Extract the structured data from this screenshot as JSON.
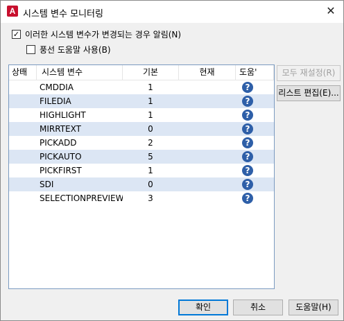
{
  "window": {
    "title": "시스템 변수 모니터링",
    "app_icon_letter": "A",
    "close_glyph": "✕"
  },
  "options": {
    "notify_label": "이러한 시스템 변수가 변경되는 경우 알림(N)",
    "notify_checked": true,
    "balloon_label": "풍선 도움말 사용(B)",
    "balloon_checked": false
  },
  "grid": {
    "columns": {
      "status": "상태",
      "name": "시스템 변수",
      "default": "기본",
      "current": "현재",
      "help": "도움'"
    },
    "rows": [
      {
        "name": "CMDDIA",
        "default": "1",
        "current": ""
      },
      {
        "name": "FILEDIA",
        "default": "1",
        "current": ""
      },
      {
        "name": "HIGHLIGHT",
        "default": "1",
        "current": ""
      },
      {
        "name": "MIRRTEXT",
        "default": "0",
        "current": ""
      },
      {
        "name": "PICKADD",
        "default": "2",
        "current": ""
      },
      {
        "name": "PICKAUTO",
        "default": "5",
        "current": ""
      },
      {
        "name": "PICKFIRST",
        "default": "1",
        "current": ""
      },
      {
        "name": "SDI",
        "default": "0",
        "current": ""
      },
      {
        "name": "SELECTIONPREVIEW",
        "default": "3",
        "current": ""
      }
    ],
    "help_glyph": "?"
  },
  "side_buttons": {
    "reset_all": "모두 재설정(R)",
    "edit_list": "리스트 편집(E)..."
  },
  "footer": {
    "ok": "확인",
    "cancel": "취소",
    "help": "도움말(H)"
  },
  "colors": {
    "accent": "#0078d7",
    "row_alt": "#dce6f4",
    "help_icon": "#2e5fa8",
    "app_icon": "#c8102e"
  }
}
